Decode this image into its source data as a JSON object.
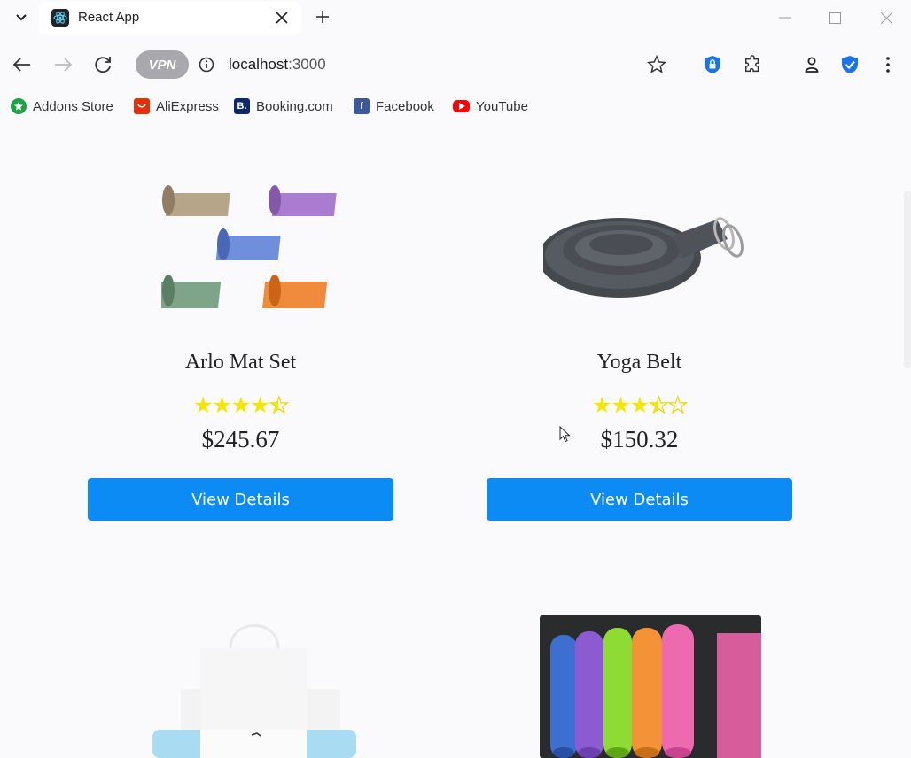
{
  "browser": {
    "tab_title": "React App",
    "vpn_label": "VPN",
    "address": {
      "host": "localhost",
      "port": ":3000"
    },
    "bookmarks": [
      {
        "label": "Addons Store",
        "icon": "addons-store-icon",
        "color": "#1fa246"
      },
      {
        "label": "AliExpress",
        "icon": "aliexpress-icon",
        "color": "#e62e04"
      },
      {
        "label": "Booking.com",
        "icon": "booking-icon",
        "color": "#0c2a6b"
      },
      {
        "label": "Facebook",
        "icon": "facebook-icon",
        "color": "#3b5998"
      },
      {
        "label": "YouTube",
        "icon": "youtube-icon",
        "color": "#ff0000"
      }
    ]
  },
  "products": [
    {
      "name": "Arlo Mat Set",
      "price": "$245.67",
      "rating": 4.5,
      "button_label": "View Details"
    },
    {
      "name": "Yoga Belt",
      "price": "$150.32",
      "rating": 3.5,
      "button_label": "View Details"
    }
  ],
  "colors": {
    "accent": "#0d8bf5",
    "star": "#f5e600"
  }
}
